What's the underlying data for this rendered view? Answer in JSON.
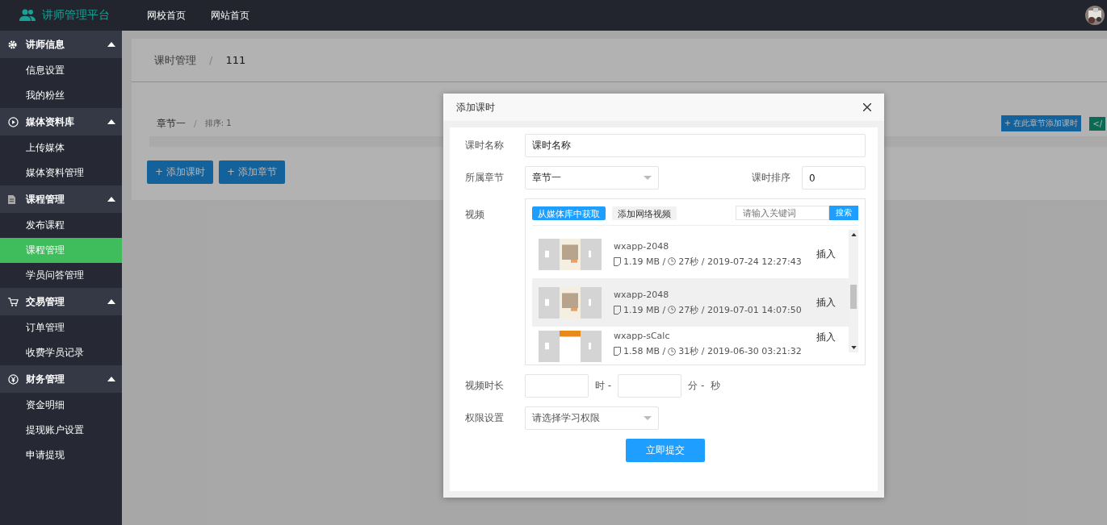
{
  "topbar": {
    "brand": "讲师管理平台",
    "nav": [
      "网校首页",
      "网站首页"
    ]
  },
  "sidebar": {
    "groups": [
      {
        "label": "讲师信息",
        "kind": "gear",
        "expanded": true,
        "items": [
          {
            "label": "信息设置",
            "selected": false
          },
          {
            "label": "我的粉丝",
            "selected": false
          }
        ]
      },
      {
        "label": "媒体资料库",
        "kind": "play",
        "expanded": true,
        "items": [
          {
            "label": "上传媒体",
            "selected": false
          },
          {
            "label": "媒体资料管理",
            "selected": false
          }
        ]
      },
      {
        "label": "课程管理",
        "kind": "doc",
        "expanded": true,
        "items": [
          {
            "label": "发布课程",
            "selected": false
          },
          {
            "label": "课程管理",
            "selected": true
          },
          {
            "label": "学员问答管理",
            "selected": false
          }
        ]
      },
      {
        "label": "交易管理",
        "kind": "cart",
        "expanded": true,
        "items": [
          {
            "label": "订单管理",
            "selected": false
          },
          {
            "label": "收费学员记录",
            "selected": false
          }
        ]
      },
      {
        "label": "财务管理",
        "kind": "yen",
        "expanded": true,
        "items": [
          {
            "label": "资金明细",
            "selected": false
          },
          {
            "label": "提现账户设置",
            "selected": false
          },
          {
            "label": "申请提现",
            "selected": false
          }
        ]
      }
    ]
  },
  "main": {
    "breadcrumb": [
      "课时管理",
      "111"
    ],
    "breadcrumb_separator": "/",
    "chapter": {
      "name": "章节一",
      "separator": "/",
      "sort": "排序: 1",
      "buttons": [
        "+ 在此章节添加课时",
        "</"
      ]
    },
    "buttons": [
      "+ 添加课时",
      "+ 添加章节"
    ]
  },
  "modal": {
    "title": "添加课时",
    "name": {
      "label": "课时名称",
      "value": "课时名称"
    },
    "chapter": {
      "label": "所属章节",
      "value": "章节一"
    },
    "order": {
      "label": "课时排序",
      "value": "0"
    },
    "video": {
      "label": "视频",
      "tabs": [
        {
          "label": "从媒体库中获取",
          "selected": true
        },
        {
          "label": "添加网络视频",
          "selected": false
        }
      ],
      "search": {
        "placeholder": "请输入关键词",
        "button": "搜索"
      },
      "rows": [
        {
          "title": "wxapp-2048",
          "size": "1.19 MB /",
          "duration": "27秒 / 2019-07-24 12:27:43",
          "action": "插入",
          "selected": false
        },
        {
          "title": "wxapp-2048",
          "size": "1.19 MB /",
          "duration": "27秒 / 2019-07-01 14:07:50",
          "action": "插入",
          "selected": true
        },
        {
          "title": "wxapp-sCalc",
          "size": "1.58 MB /",
          "duration": "31秒 / 2019-06-30 03:21:32",
          "action": "插入",
          "selected": false
        }
      ]
    },
    "duration": {
      "label": "视频时长",
      "units": [
        "时 -",
        "分 -",
        "秒"
      ]
    },
    "permission": {
      "label": "权限设置",
      "placeholder": "请选择学习权限"
    },
    "submit": "立即提交"
  }
}
